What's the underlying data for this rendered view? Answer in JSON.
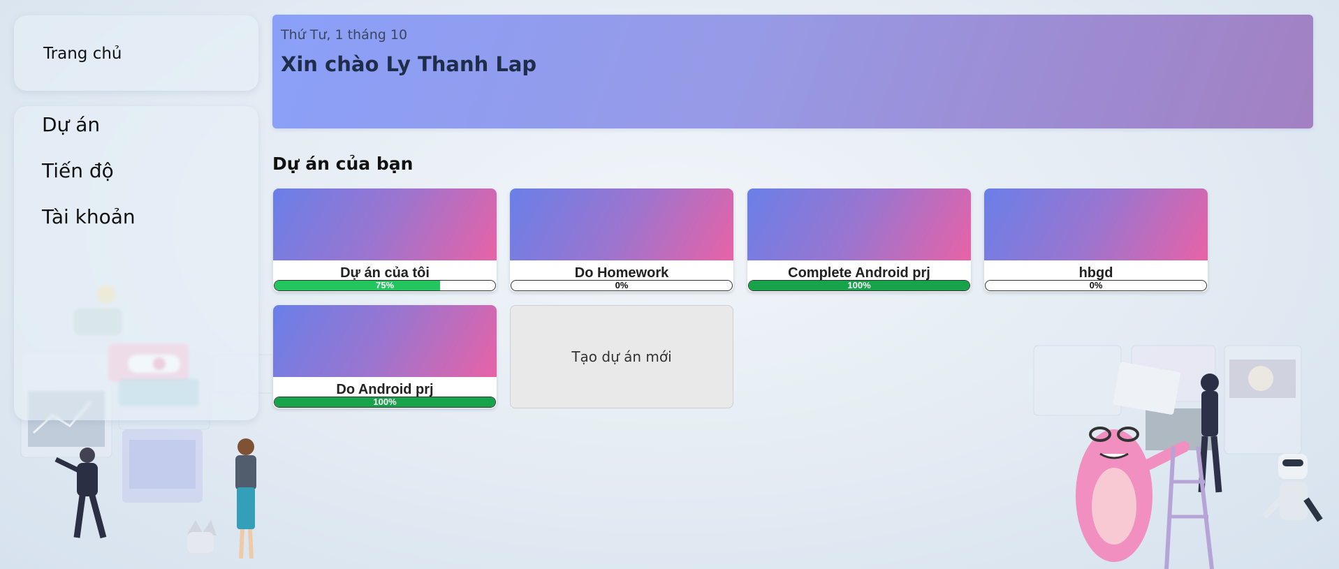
{
  "sidebar": {
    "home_label": "Trang chủ",
    "menu": [
      {
        "label": "Dự án"
      },
      {
        "label": "Tiến độ"
      },
      {
        "label": "Tài khoản"
      }
    ]
  },
  "banner": {
    "date": "Thứ Tư, 1 tháng 10",
    "greeting": "Xin chào Ly Thanh Lap"
  },
  "projects_section": {
    "title": "Dự án của bạn",
    "projects": [
      {
        "name": "Dự án của tôi",
        "progress": 75,
        "progress_label": "75%"
      },
      {
        "name": "Do Homework",
        "progress": 0,
        "progress_label": "0%"
      },
      {
        "name": "Complete Android prj",
        "progress": 100,
        "progress_label": "100%"
      },
      {
        "name": "hbgd",
        "progress": 0,
        "progress_label": "0%"
      },
      {
        "name": "Do Android prj",
        "progress": 100,
        "progress_label": "100%"
      }
    ],
    "new_project_label": "Tạo dự án mới"
  },
  "colors": {
    "progress_fill": "#22c55e",
    "progress_complete": "#16a34a",
    "card_gradient_start": "#6a7fe8",
    "card_gradient_end": "#e862a6"
  }
}
